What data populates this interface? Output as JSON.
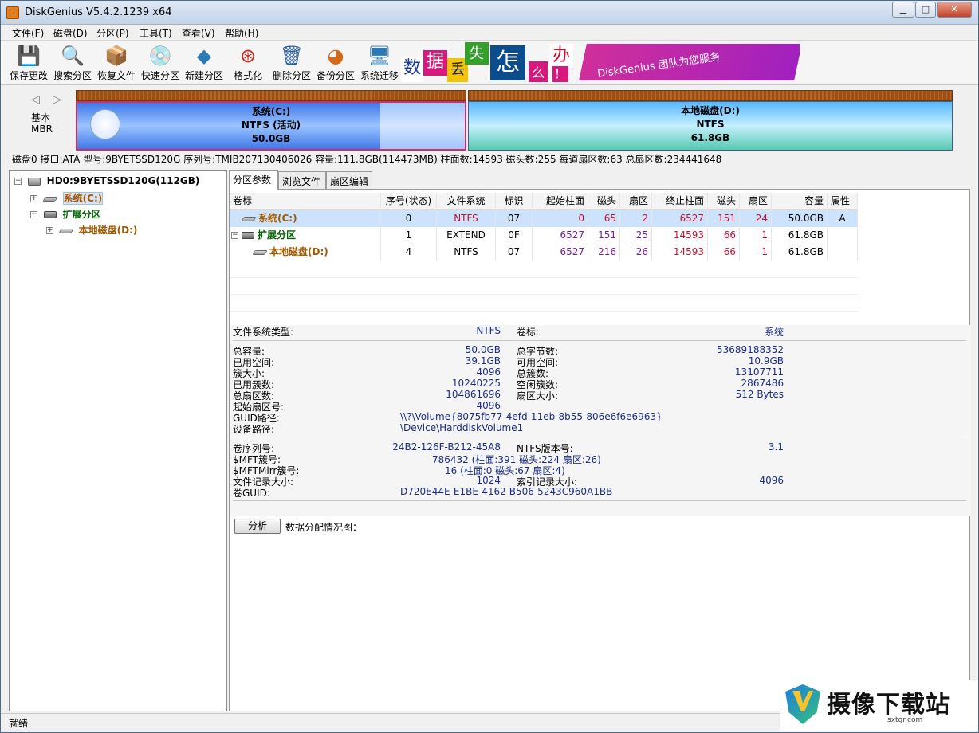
{
  "window": {
    "title": "DiskGenius V5.4.2.1239 x64",
    "min_glyph": "▁",
    "max_glyph": "□",
    "close_glyph": "✕"
  },
  "menu": [
    "文件(F)",
    "磁盘(D)",
    "分区(P)",
    "工具(T)",
    "查看(V)",
    "帮助(H)"
  ],
  "toolbar": [
    {
      "label": "保存更改",
      "icon": "save-icon",
      "glyph": "💾",
      "color": "#555"
    },
    {
      "label": "搜索分区",
      "icon": "search-icon",
      "glyph": "🔍",
      "color": "#a0522d"
    },
    {
      "label": "恢复文件",
      "icon": "recover-files-icon",
      "glyph": "📦",
      "color": "#6b4e16"
    },
    {
      "label": "快速分区",
      "icon": "quick-partition-icon",
      "glyph": "💿",
      "color": "#888"
    },
    {
      "label": "新建分区",
      "icon": "new-partition-icon",
      "glyph": "◆",
      "color": "#2a7ab8"
    },
    {
      "label": "格式化",
      "icon": "format-icon",
      "glyph": "⊛",
      "color": "#c8281e"
    },
    {
      "label": "删除分区",
      "icon": "delete-partition-icon",
      "glyph": "🗑",
      "color": "#2a5fa8"
    },
    {
      "label": "备份分区",
      "icon": "backup-partition-icon",
      "glyph": "◕",
      "color": "#d46a1a"
    },
    {
      "label": "系统迁移",
      "icon": "system-migration-icon",
      "glyph": "🖥",
      "color": "#2a7ab8"
    }
  ],
  "banner": {
    "chars": [
      "数",
      "据",
      "丢",
      "失",
      "怎",
      "么",
      "办",
      "！"
    ],
    "slogan": "DiskGenius 团队为您服务"
  },
  "diskmap": {
    "nav": "◁ ▷",
    "label_line1": "基本",
    "label_line2": "MBR",
    "partitions": [
      {
        "name": "系统(C:)",
        "fs": "NTFS (活动)",
        "size": "50.0GB"
      },
      {
        "name": "本地磁盘(D:)",
        "fs": "NTFS",
        "size": "61.8GB"
      }
    ]
  },
  "disk_info": "磁盘0 接口:ATA  型号:9BYETSSD120G  序列号:TMIB207130406026  容量:111.8GB(114473MB)  柱面数:14593  磁头数:255  每道扇区数:63  总扇区数:234441648",
  "tree": {
    "disk": "HD0:9BYETSSD120G(112GB)",
    "items": [
      "系统(C:)",
      "扩展分区",
      "本地磁盘(D:)"
    ]
  },
  "tabs": [
    "分区参数",
    "浏览文件",
    "扇区编辑"
  ],
  "table": {
    "headers": [
      "卷标",
      "序号(状态)",
      "文件系统",
      "标识",
      "起始柱面",
      "磁头",
      "扇区",
      "终止柱面",
      "磁头",
      "扇区",
      "容量",
      "属性"
    ],
    "rows": [
      [
        "系统(C:)",
        "0",
        "NTFS",
        "07",
        "0",
        "65",
        "2",
        "6527",
        "151",
        "24",
        "50.0GB",
        "A"
      ],
      [
        "扩展分区",
        "1",
        "EXTEND",
        "0F",
        "6527",
        "151",
        "25",
        "14593",
        "66",
        "1",
        "61.8GB",
        ""
      ],
      [
        "本地磁盘(D:)",
        "4",
        "NTFS",
        "07",
        "6527",
        "216",
        "26",
        "14593",
        "66",
        "1",
        "61.8GB",
        ""
      ]
    ]
  },
  "details": {
    "fs_type_label": "文件系统类型:",
    "fs_type_value": "NTFS",
    "volume_label_label": "卷标:",
    "volume_label_value": "系统",
    "left": [
      {
        "k": "总容量:",
        "v": "50.0GB"
      },
      {
        "k": "已用空间:",
        "v": "39.1GB"
      },
      {
        "k": "簇大小:",
        "v": "4096"
      },
      {
        "k": "已用簇数:",
        "v": "10240225"
      },
      {
        "k": "总扇区数:",
        "v": "104861696"
      },
      {
        "k": "起始扇区号:",
        "v": "4096"
      }
    ],
    "right": [
      {
        "k": "总字节数:",
        "v": "53689188352"
      },
      {
        "k": "可用空间:",
        "v": "10.9GB"
      },
      {
        "k": "总簇数:",
        "v": "13107711"
      },
      {
        "k": "空闲簇数:",
        "v": "2867486"
      },
      {
        "k": "扇区大小:",
        "v": "512 Bytes"
      }
    ],
    "guid_path_label": "GUID路径:",
    "guid_path_value": "\\\\?\\Volume{8075fb77-4efd-11eb-8b55-806e6f6e6963}",
    "device_path_label": "设备路径:",
    "device_path_value": "\\Device\\HarddiskVolume1",
    "serial_label": "卷序列号:",
    "serial_value": "24B2-126F-B212-45A8",
    "ntfs_ver_label": "NTFS版本号:",
    "ntfs_ver_value": "3.1",
    "mft_label": "$MFT簇号:",
    "mft_value": "786432 (柱面:391 磁头:224 扇区:26)",
    "mftmirr_label": "$MFTMirr簇号:",
    "mftmirr_value": "16 (柱面:0 磁头:67 扇区:4)",
    "record_size_label": "文件记录大小:",
    "record_size_value": "1024",
    "index_size_label": "索引记录大小:",
    "index_size_value": "4096",
    "volume_guid_label": "卷GUID:",
    "volume_guid_value": "D720E44E-E1BE-4162-B506-5243C960A1BB"
  },
  "analyze": {
    "button": "分析",
    "label": "数据分配情况图："
  },
  "status": "就绪",
  "watermark": {
    "text": "摄像下载站",
    "url": "sxtgr.com"
  }
}
